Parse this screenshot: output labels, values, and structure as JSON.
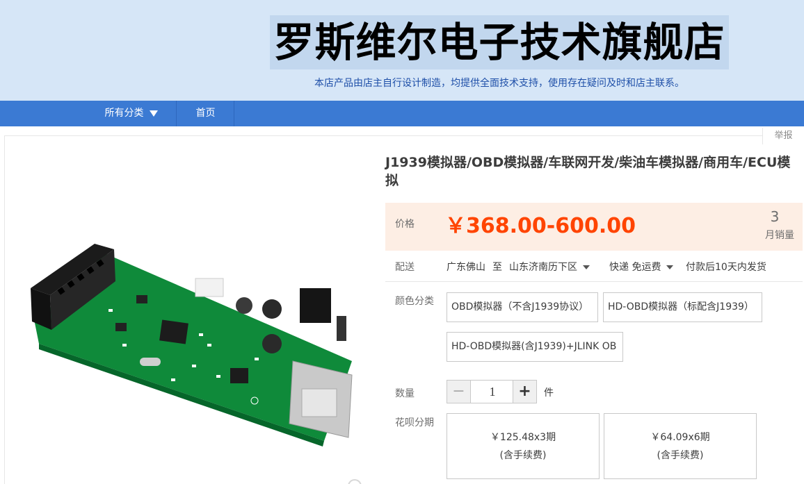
{
  "shop": {
    "name": "罗斯维尔电子技术旗舰店",
    "slogan": "本店产品由店主自行设计制造，均提供全面技术支持，使用存在疑问及时和店主联系。"
  },
  "nav": {
    "all_categories": "所有分类",
    "home": "首页"
  },
  "report": "举报",
  "product": {
    "title": "J1939模拟器/OBD模拟器/车联网开发/柴油车模拟器/商用车/ECU模拟",
    "price_label": "价格",
    "price": "￥368.00-600.00",
    "monthly_sales": "3",
    "monthly_sales_label": "月销量",
    "price_color": "#ff4400"
  },
  "shipping": {
    "label": "配送",
    "from": "广东佛山",
    "to_word": "至",
    "destination": "山东济南历下区",
    "method": "快递 免运费",
    "dispatch": "付款后10天内发货"
  },
  "sku": {
    "label": "颜色分类",
    "options": [
      "OBD模拟器（不含J1939协议）",
      "HD-OBD模拟器（标配含J1939）",
      "HD-OBD模拟器(含J1939)+JLINK OB"
    ]
  },
  "quantity": {
    "label": "数量",
    "value": "1",
    "minus": "−",
    "plus": "+",
    "unit": "件"
  },
  "installment": {
    "label": "花呗分期",
    "options": [
      {
        "amount": "￥125.48x3期",
        "fee": "(含手续费)"
      },
      {
        "amount": "￥64.09x6期",
        "fee": "(含手续费)"
      }
    ]
  },
  "icons": {
    "dropdown": "caret-down-icon",
    "product_image": "pcb-board-image"
  },
  "colors": {
    "banner": "#d6e6f7",
    "nav": "#3b7ad3",
    "price_box": "#fdeee4"
  }
}
